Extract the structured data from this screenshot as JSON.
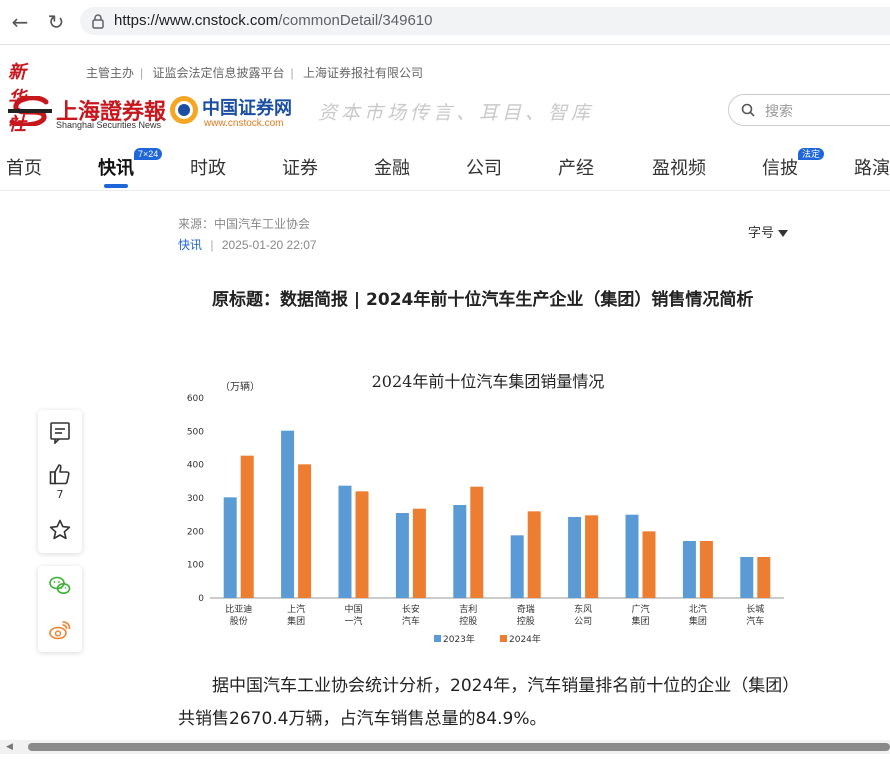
{
  "browser": {
    "url_host": "https://www.cnstock.com",
    "url_path": "/commonDetail/349610"
  },
  "topline": {
    "brand": "新华社",
    "links": [
      "主管主办",
      "证监会法定信息披露平台",
      "上海证券报社有限公司"
    ]
  },
  "logos": {
    "shanghai_cn": "上海證券報",
    "shanghai_en": "Shanghai Securities News",
    "cnstock_cn": "中国证券网",
    "cnstock_en": "www.cnstock.com",
    "slogan": "资本市场传言、耳目、智库"
  },
  "search": {
    "placeholder": "搜索"
  },
  "nav": {
    "items": [
      "首页",
      "快讯",
      "时政",
      "证券",
      "金融",
      "公司",
      "产经",
      "盈视频",
      "信披",
      "路演"
    ],
    "badge_kuaixun": "7×24",
    "badge_xinpi": "法定"
  },
  "article": {
    "source": "来源：中国汽车工业协会",
    "category": "快讯",
    "datetime": "2025-01-20 22:07",
    "font_size_label": "字号",
    "headline": "原标题：数据简报 | 2024年前十位汽车生产企业（集团）销售情况简析",
    "paragraph": "据中国汽车工业协会统计分析，2024年，汽车销量排名前十位的企业（集团）共销售2670.4万辆，占汽车销售总量的84.9%。"
  },
  "side": {
    "like_count": "7"
  },
  "colors": {
    "accent": "#1f66d8",
    "brand_red": "#c8161d",
    "bar_2023": "#5b9bd5",
    "bar_2024": "#ed7d31"
  },
  "chart_data": {
    "type": "bar",
    "title": "2024年前十位汽车集团销量情况",
    "unit_label": "（万辆）",
    "categories": [
      "比亚迪\n股份",
      "上汽\n集团",
      "中国\n一汽",
      "长安\n汽车",
      "吉利\n控股",
      "奇瑞\n控股",
      "东风\n公司",
      "广汽\n集团",
      "北汽\n集团",
      "长城\n汽车"
    ],
    "series": [
      {
        "name": "2023年",
        "values": [
          302,
          502,
          337,
          255,
          279,
          188,
          243,
          250,
          171,
          123
        ]
      },
      {
        "name": "2024年",
        "values": [
          427,
          401,
          320,
          268,
          334,
          260,
          248,
          200,
          171,
          123
        ]
      }
    ],
    "yticks": [
      0,
      100,
      200,
      300,
      400,
      500,
      600
    ],
    "ylim": [
      0,
      600
    ]
  }
}
